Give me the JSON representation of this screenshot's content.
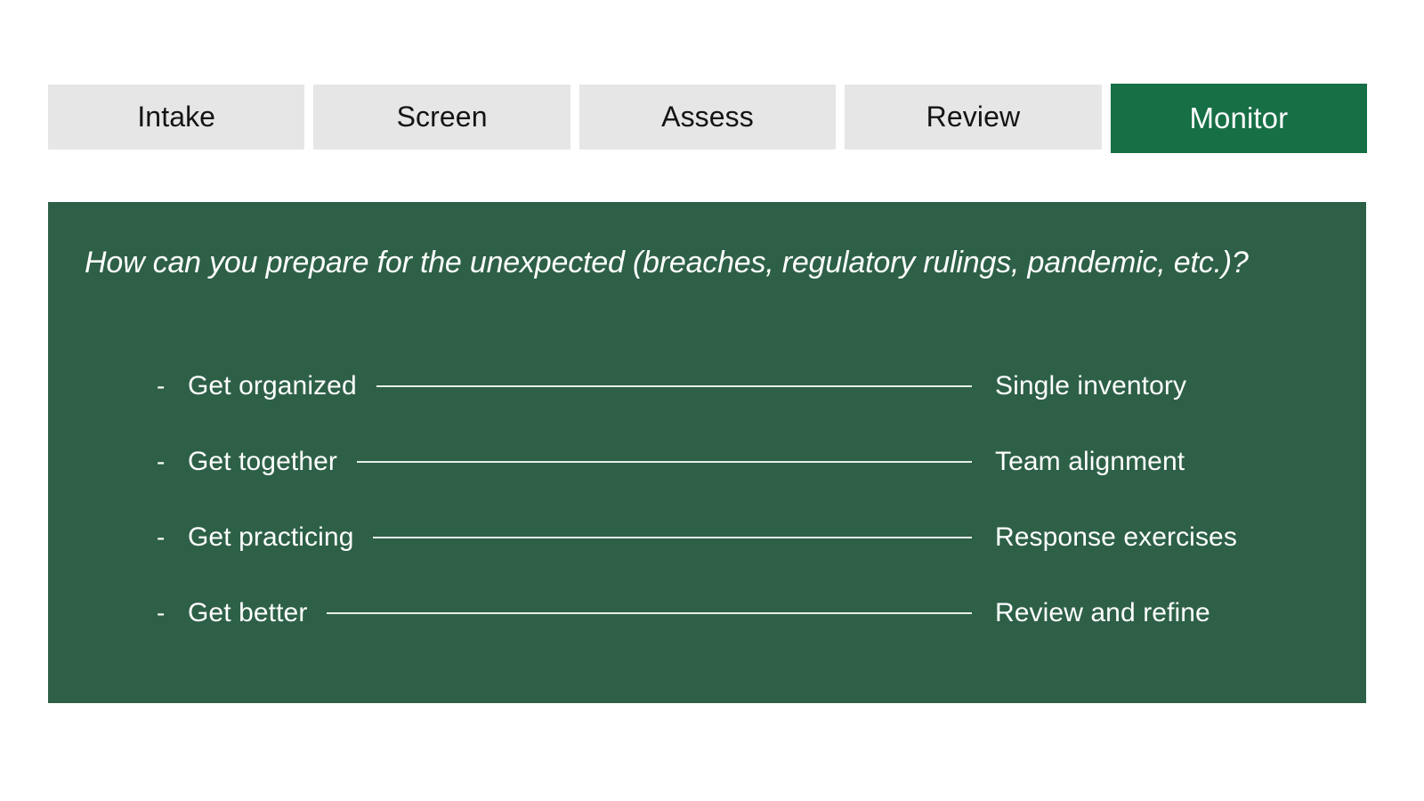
{
  "tabs": [
    {
      "label": "Intake",
      "active": false
    },
    {
      "label": "Screen",
      "active": false
    },
    {
      "label": "Assess",
      "active": false
    },
    {
      "label": "Review",
      "active": false
    },
    {
      "label": "Monitor",
      "active": true
    }
  ],
  "panel": {
    "heading": "How can you prepare for the unexpected (breaches, regulatory rulings, pandemic, etc.)?",
    "bullet_marker": "-",
    "rows": [
      {
        "left": "Get organized",
        "right": "Single inventory"
      },
      {
        "left": "Get together",
        "right": "Team alignment"
      },
      {
        "left": "Get practicing",
        "right": "Response exercises"
      },
      {
        "left": "Get better",
        "right": "Review and refine"
      }
    ]
  },
  "colors": {
    "tab_inactive_bg": "#e6e6e6",
    "tab_inactive_text": "#141414",
    "tab_active_bg": "#176f46",
    "tab_active_text": "#ffffff",
    "panel_bg": "#2d6047",
    "panel_text": "#ffffff",
    "connector_line": "#f2f6f3",
    "page_bg": "#ffffff"
  }
}
